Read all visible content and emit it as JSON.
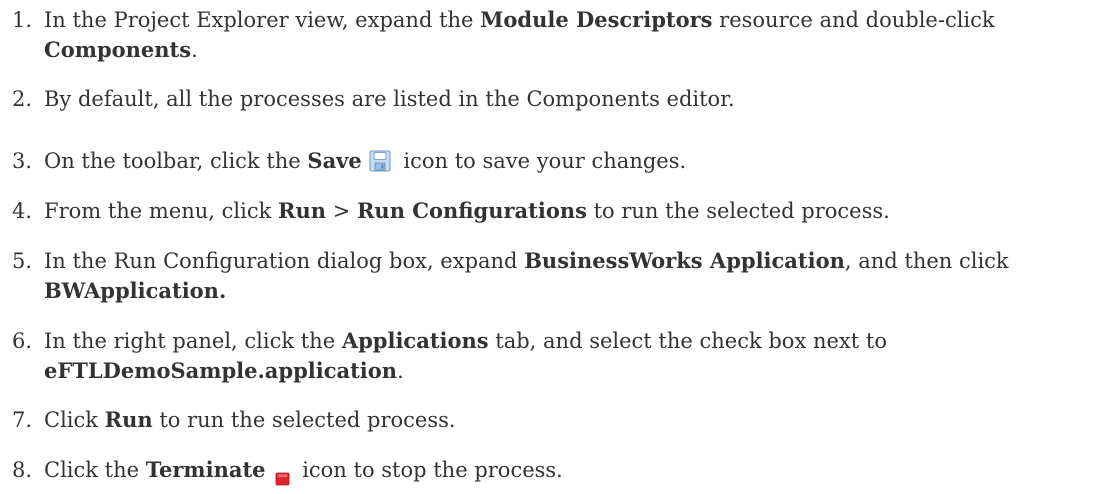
{
  "steps": [
    {
      "num": "1.",
      "t1": "In the Project Explorer view, expand the ",
      "b1": "Module Descriptors",
      "t2": " resource and double-click",
      "b2": "Components",
      "t3": "."
    },
    {
      "num": "2.",
      "t1": "By default, all the processes are listed in the Components editor."
    },
    {
      "num": "3.",
      "t1": "On the toolbar, click the ",
      "b1": "Save",
      "icon": "save-icon",
      "t2": " icon to save your changes."
    },
    {
      "num": "4.",
      "t1": "From the menu, click ",
      "b1": "Run",
      "t2": " > ",
      "b2": "Run Configurations",
      "t3": " to run the selected process."
    },
    {
      "num": "5.",
      "t1": "In the Run Configuration dialog box, expand ",
      "b1": "BusinessWorks Application",
      "t2": ", and then click",
      "b2": "BWApplication."
    },
    {
      "num": "6.",
      "t1": "In the right panel, click the ",
      "b1": "Applications",
      "t2": " tab, and select the check box next to",
      "b2": "eFTLDemoSample.application",
      "t3": "."
    },
    {
      "num": "7.",
      "t1": "Click ",
      "b1": "Run",
      "t2": " to run the selected process."
    },
    {
      "num": "8.",
      "t1": "Click the ",
      "b1": "Terminate",
      "icon": "terminate-icon",
      "t2": " icon to stop the process."
    }
  ],
  "colors": {
    "text": "#333333",
    "save_icon": "#7fa7d4",
    "terminate_icon": "#e0242a"
  }
}
